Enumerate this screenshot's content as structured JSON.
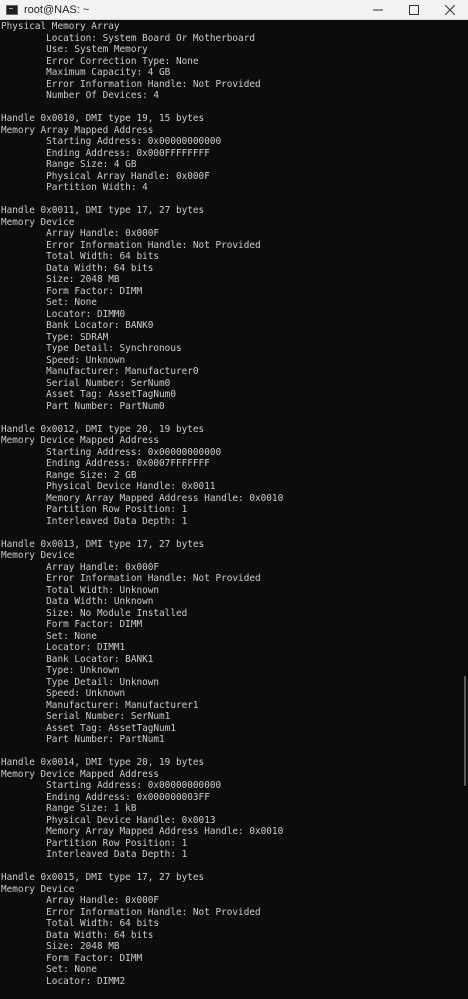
{
  "window": {
    "title": "root@NAS: ~",
    "icons": {
      "app": "terminal-icon",
      "minimize": "minimize-icon",
      "maximize": "maximize-icon",
      "close": "close-icon"
    }
  },
  "terminal": {
    "lines": [
      "Physical Memory Array",
      "        Location: System Board Or Motherboard",
      "        Use: System Memory",
      "        Error Correction Type: None",
      "        Maximum Capacity: 4 GB",
      "        Error Information Handle: Not Provided",
      "        Number Of Devices: 4",
      "",
      "Handle 0x0010, DMI type 19, 15 bytes",
      "Memory Array Mapped Address",
      "        Starting Address: 0x00000000000",
      "        Ending Address: 0x000FFFFFFFF",
      "        Range Size: 4 GB",
      "        Physical Array Handle: 0x000F",
      "        Partition Width: 4",
      "",
      "Handle 0x0011, DMI type 17, 27 bytes",
      "Memory Device",
      "        Array Handle: 0x000F",
      "        Error Information Handle: Not Provided",
      "        Total Width: 64 bits",
      "        Data Width: 64 bits",
      "        Size: 2048 MB",
      "        Form Factor: DIMM",
      "        Set: None",
      "        Locator: DIMM0",
      "        Bank Locator: BANK0",
      "        Type: SDRAM",
      "        Type Detail: Synchronous",
      "        Speed: Unknown",
      "        Manufacturer: Manufacturer0",
      "        Serial Number: SerNum0",
      "        Asset Tag: AssetTagNum0",
      "        Part Number: PartNum0",
      "",
      "Handle 0x0012, DMI type 20, 19 bytes",
      "Memory Device Mapped Address",
      "        Starting Address: 0x00000000000",
      "        Ending Address: 0x0007FFFFFFF",
      "        Range Size: 2 GB",
      "        Physical Device Handle: 0x0011",
      "        Memory Array Mapped Address Handle: 0x0010",
      "        Partition Row Position: 1",
      "        Interleaved Data Depth: 1",
      "",
      "Handle 0x0013, DMI type 17, 27 bytes",
      "Memory Device",
      "        Array Handle: 0x000F",
      "        Error Information Handle: Not Provided",
      "        Total Width: Unknown",
      "        Data Width: Unknown",
      "        Size: No Module Installed",
      "        Form Factor: DIMM",
      "        Set: None",
      "        Locator: DIMM1",
      "        Bank Locator: BANK1",
      "        Type: Unknown",
      "        Type Detail: Unknown",
      "        Speed: Unknown",
      "        Manufacturer: Manufacturer1",
      "        Serial Number: SerNum1",
      "        Asset Tag: AssetTagNum1",
      "        Part Number: PartNum1",
      "",
      "Handle 0x0014, DMI type 20, 19 bytes",
      "Memory Device Mapped Address",
      "        Starting Address: 0x00000000000",
      "        Ending Address: 0x000000003FF",
      "        Range Size: 1 kB",
      "        Physical Device Handle: 0x0013",
      "        Memory Array Mapped Address Handle: 0x0010",
      "        Partition Row Position: 1",
      "        Interleaved Data Depth: 1",
      "",
      "Handle 0x0015, DMI type 17, 27 bytes",
      "Memory Device",
      "        Array Handle: 0x000F",
      "        Error Information Handle: Not Provided",
      "        Total Width: 64 bits",
      "        Data Width: 64 bits",
      "        Size: 2048 MB",
      "        Form Factor: DIMM",
      "        Set: None",
      "        Locator: DIMM2"
    ]
  },
  "colors": {
    "terminal_bg": "#0c0c0c",
    "terminal_fg": "#cccccc",
    "titlebar_bg": "#f3f3f3"
  }
}
